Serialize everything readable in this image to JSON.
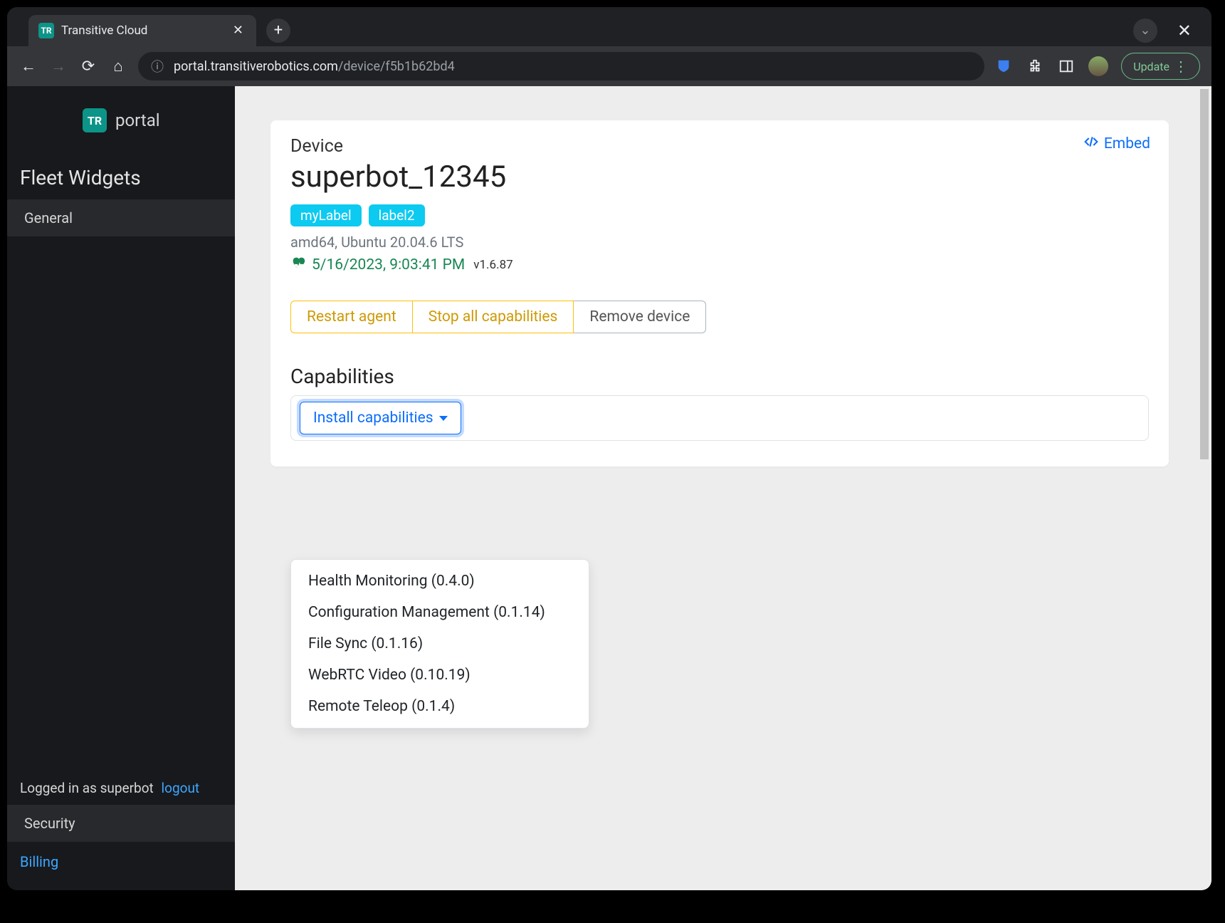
{
  "browser": {
    "tab_title": "Transitive Cloud",
    "url_host": "portal.transitiverobotics.com",
    "url_path": "/device/f5b1b62bd4",
    "update_label": "Update"
  },
  "sidebar": {
    "brand": "portal",
    "section_title": "Fleet Widgets",
    "items": [
      "General"
    ],
    "logged_in_prefix": "Logged in as ",
    "logged_in_user": "superbot",
    "logout_label": "logout",
    "security_label": "Security",
    "billing_label": "Billing"
  },
  "device": {
    "embed_label": "Embed",
    "label": "Device",
    "name": "superbot_12345",
    "tags": [
      "myLabel",
      "label2"
    ],
    "system": "amd64, Ubuntu 20.04.6 LTS",
    "heartbeat": "5/16/2023, 9:03:41 PM",
    "version": "v1.6.87",
    "actions": {
      "restart": "Restart agent",
      "stop": "Stop all capabilities",
      "remove": "Remove device"
    },
    "caps_title": "Capabilities",
    "install_label": "Install capabilities",
    "dropdown": [
      "Health Monitoring (0.4.0)",
      "Configuration Management (0.1.14)",
      "File Sync (0.1.16)",
      "WebRTC Video (0.10.19)",
      "Remote Teleop (0.1.4)"
    ]
  }
}
